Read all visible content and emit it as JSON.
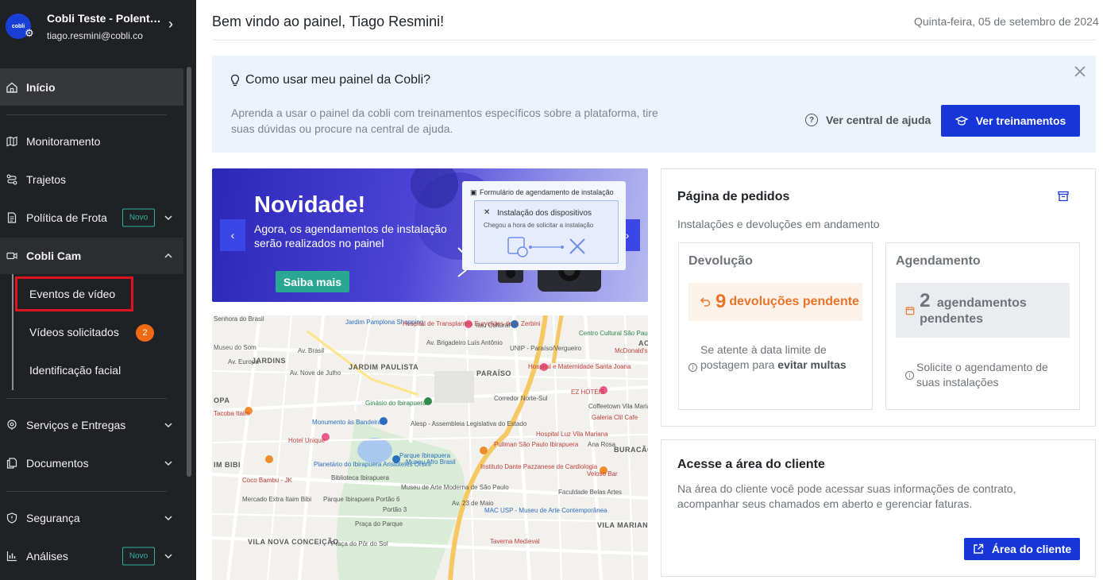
{
  "account": {
    "avatar_text": "cobli",
    "name": "Cobli Teste - Polentas ...",
    "email": "tiago.resmini@cobli.co"
  },
  "nav": {
    "inicio": "Início",
    "monitoramento": "Monitoramento",
    "trajetos": "Trajetos",
    "politica": "Política de Frota",
    "novo_badge": "Novo",
    "cobli_cam": "Cobli Cam",
    "eventos_video": "Eventos de vídeo",
    "videos_solicitados": "Vídeos solicitados",
    "videos_count": "2",
    "identificacao": "Identificação facial",
    "servicos": "Serviços e Entregas",
    "documentos": "Documentos",
    "seguranca": "Segurança",
    "analises": "Análises"
  },
  "header": {
    "welcome": "Bem vindo ao painel, Tiago Resmini!",
    "date": "Quinta-feira, 05 de setembro de 2024"
  },
  "help": {
    "title": "Como usar meu painel da Cobli?",
    "text": "Aprenda a usar o painel da cobli com treinamentos específicos sobre a plataforma, tire suas dúvidas ou procure na central de ajuda.",
    "link": "Ver central de ajuda",
    "button": "Ver treinamentos"
  },
  "banner": {
    "heading": "Novidade!",
    "subtitle": "Agora, os agendamentos de instalação serão realizados no painel",
    "button": "Saiba mais",
    "form_title": "Formulário de agendamento de instalação",
    "form_inner_title": "Instalação dos dispositivos",
    "form_inner_sub": "Chegou a hora de solicitar a instalação"
  },
  "map": {
    "labels": [
      "Senhora do Brasil",
      "Jardim Pamplona Shopping",
      "Hospital de Transplantes Euryclides de J. Zerbini",
      "Itaú Cultural",
      "Centro Cultural São Paulo",
      "JARDINS",
      "JARDIM PAULISTA",
      "PARAÍSO",
      "UNIP - Paraíso/Vergueiro",
      "McDonald's",
      "Hospital e Maternidade Santa Joana",
      "EZ HOTÉIS",
      "Coffeetown Vila Mariana",
      "Galeria Clil Cafe",
      "Ginásio do Ibirapuera",
      "Monumento às Bandeiras",
      "Alesp - Assembleia Legislativa do Estado",
      "Pullman São Paulo Ibirapuera",
      "Hospital Luz Vila Mariana",
      "Ana Rosa",
      "Hotel Unique",
      "Parque Ibirapuera",
      "Museu Afro Brasil",
      "Planetário do Ibirapuera Aristóteles Orsini",
      "Museu de Arte Moderna de São Paulo",
      "Instituto Dante Pazzanese de Cardiologia",
      "Coco Bambu - JK",
      "Mercado Extra Itaim Bibi",
      "Parque Ibirapuera Portão 6",
      "MAC USP - Museu de Arte Contemporânea",
      "VILA MARIANA",
      "VILA NOVA CONCEIÇÃO",
      "Praça do Pôr do Sol",
      "Faculdade Belas Artes",
      "Veloso Bar",
      "BURACÃO",
      "Av. Brasil",
      "Av. Nove de Julho",
      "Corredor Norte-Sul",
      "Av. 23 de Maio",
      "Av. Brigadeiro Luís Antônio",
      "Av. Europa",
      "Tacoba Itaim",
      "Biblioteca Ibirapuera",
      "Portão 3",
      "Museu do Som",
      "OPA",
      "IM BIBI",
      "Praça do Parque",
      "Taverna Medieval",
      "AC"
    ]
  },
  "orders": {
    "title": "Página de pedidos",
    "subtitle": "Instalações e devoluções em andamento",
    "devolucao_title": "Devolução",
    "devolucao_count": "9",
    "devolucao_label": "devoluções pendente",
    "devolucao_note_a": "Se atente à data limite de postagem para",
    "devolucao_note_b": "evitar multas",
    "agendamento_title": "Agendamento",
    "agendamento_count": "2",
    "agendamento_label": "agendamentos pendentes",
    "agendamento_note": "Solicite o agendamento de suas instalações",
    "colors": {
      "devolucao_bg": "#fdf2e9",
      "devolucao_fg": "#e9752a",
      "agendamento_bg": "#eaecf0",
      "agendamento_fg": "#6f747a"
    }
  },
  "client": {
    "title": "Acesse a área do cliente",
    "text": "Na área do cliente você pode acessar suas informações de contrato, acompanhar seus chamados em aberto e gerenciar faturas.",
    "button": "Área do cliente"
  }
}
